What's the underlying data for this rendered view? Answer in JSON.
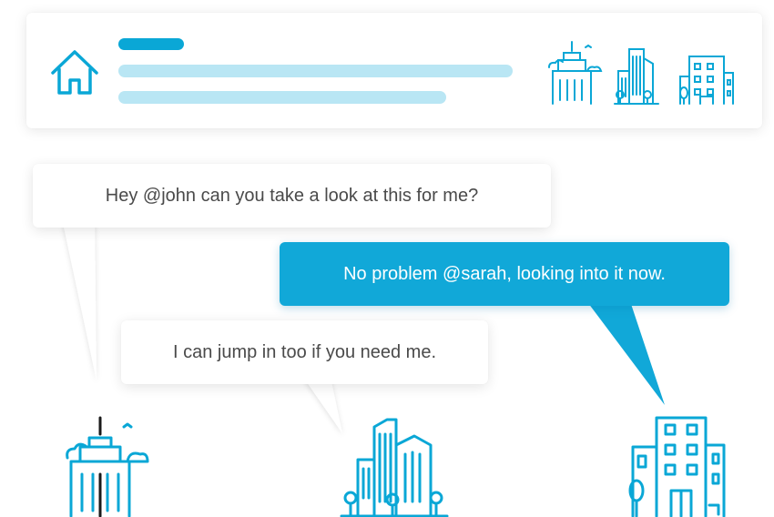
{
  "header_card": {
    "icons": [
      "home-icon",
      "skyscraper-icon",
      "city-buildings-icon",
      "office-building-icon"
    ]
  },
  "messages": [
    {
      "text": "Hey @john can you take a look at this for me?",
      "style": "white"
    },
    {
      "text": "No problem @sarah, looking into it now.",
      "style": "blue"
    },
    {
      "text": "I can jump in too if you need me.",
      "style": "white"
    }
  ],
  "colors": {
    "accent": "#11a8d8",
    "placeholder": "#b9e6f4",
    "text": "#4a4a4a"
  }
}
